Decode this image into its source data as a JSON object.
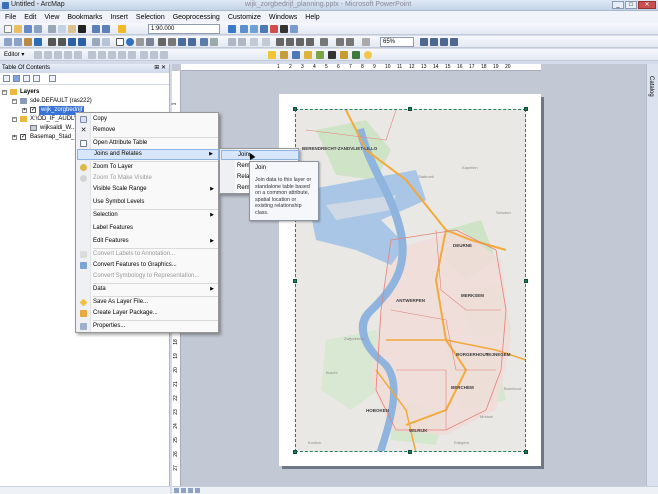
{
  "window": {
    "title": "Untitled - ArcMap",
    "center_title": "wijk_zorgbedrijf_planning.pptx - Microsoft PowerPoint",
    "buttons": {
      "minimize": "_",
      "maximize": "□",
      "close": "✕"
    }
  },
  "menubar": [
    "File",
    "Edit",
    "View",
    "Bookmarks",
    "Insert",
    "Selection",
    "Geoprocessing",
    "Customize",
    "Windows",
    "Help"
  ],
  "toolbar": {
    "scale_value": "1:90.000",
    "zoom_value": "65%",
    "editor_label": "Editor ▾"
  },
  "toc": {
    "title": "Table Of Contents",
    "pin": "⊞ ✕",
    "layers_label": "Layers",
    "items": [
      {
        "label": "sde.DEFAULT (ras222)"
      },
      {
        "label": "wijk_zorgbedrijf"
      },
      {
        "label": "X:\\OD_IF_AUDL\\..."
      },
      {
        "label": "wijksaldi_W..."
      },
      {
        "label": "Basemap_Stad_..."
      }
    ]
  },
  "context_menu": {
    "items": [
      {
        "label": "Copy",
        "icon": "copy-icon",
        "disabled": false
      },
      {
        "label": "Remove",
        "icon": "remove-icon",
        "disabled": false
      },
      {
        "label": "Open Attribute Table",
        "icon": "table-icon",
        "disabled": false
      },
      {
        "label": "Joins and Relates",
        "icon": "",
        "disabled": false,
        "submenu": true,
        "hover": true
      },
      {
        "label": "Zoom To Layer",
        "icon": "zoom-layer-icon",
        "disabled": false
      },
      {
        "label": "Zoom To Make Visible",
        "icon": "zoom-visible-icon",
        "disabled": true
      },
      {
        "label": "Visible Scale Range",
        "icon": "",
        "disabled": false,
        "submenu": true
      },
      {
        "label": "Use Symbol Levels",
        "icon": "",
        "disabled": false
      },
      {
        "label": "Selection",
        "icon": "",
        "disabled": false,
        "submenu": true
      },
      {
        "label": "Label Features",
        "icon": "",
        "disabled": false
      },
      {
        "label": "Edit Features",
        "icon": "",
        "disabled": false,
        "submenu": true
      },
      {
        "label": "Convert Labels to Annotation...",
        "icon": "annotation-icon",
        "disabled": true
      },
      {
        "label": "Convert Features to Graphics...",
        "icon": "graphics-icon",
        "disabled": false
      },
      {
        "label": "Convert Symbology to Representation...",
        "icon": "representation-icon",
        "disabled": true
      },
      {
        "label": "Data",
        "icon": "",
        "disabled": false,
        "submenu": true
      },
      {
        "label": "Save As Layer File...",
        "icon": "layer-file-icon",
        "disabled": false
      },
      {
        "label": "Create Layer Package...",
        "icon": "package-icon",
        "disabled": false
      },
      {
        "label": "Properties...",
        "icon": "properties-icon",
        "disabled": false
      }
    ]
  },
  "submenu": {
    "items": [
      "Join...",
      "Remove Join(s)",
      "Relate...",
      "Remove Relate(s)"
    ]
  },
  "tooltip": {
    "title": "Join",
    "body": "Join data to this layer or standalone table based on a common attribute, spatial location or existing relationship class."
  },
  "ruler": {
    "top": [
      "1",
      "2",
      "3",
      "4",
      "5",
      "6",
      "7",
      "8",
      "9",
      "10",
      "11",
      "12",
      "13",
      "14",
      "15",
      "16",
      "17",
      "18",
      "19",
      "20"
    ],
    "left": [
      "1",
      "2",
      "3",
      "4",
      "5",
      "6",
      "7",
      "8",
      "9",
      "10",
      "11",
      "12",
      "13",
      "14",
      "15",
      "16",
      "17",
      "18",
      "19",
      "20",
      "21",
      "22",
      "23",
      "24",
      "25",
      "26",
      "27"
    ]
  },
  "catalog": {
    "label": "Catalog"
  },
  "map": {
    "labels": [
      {
        "text": "BERENDRECHT-ZANDVLIET-LILLO",
        "big": true
      },
      {
        "text": "Kapellen",
        "big": false
      },
      {
        "text": "Stabroek",
        "big": false
      },
      {
        "text": "DEURNE",
        "big": true
      },
      {
        "text": "ANTWERPEN",
        "big": true
      },
      {
        "text": "MERKSEM",
        "big": true
      },
      {
        "text": "BORGERHOUT",
        "big": true
      },
      {
        "text": "WIJNEGEM",
        "big": true
      },
      {
        "text": "BERCHEM",
        "big": true
      },
      {
        "text": "HOBOKEN",
        "big": true
      },
      {
        "text": "WILRIJK",
        "big": true
      },
      {
        "text": "Zwijndrecht",
        "big": false
      },
      {
        "text": "Mortsel",
        "big": false
      },
      {
        "text": "Edegem",
        "big": false
      },
      {
        "text": "Boechout",
        "big": false
      },
      {
        "text": "Kontich",
        "big": false
      },
      {
        "text": "Burcht",
        "big": false
      },
      {
        "text": "Schoten",
        "big": false
      }
    ]
  }
}
